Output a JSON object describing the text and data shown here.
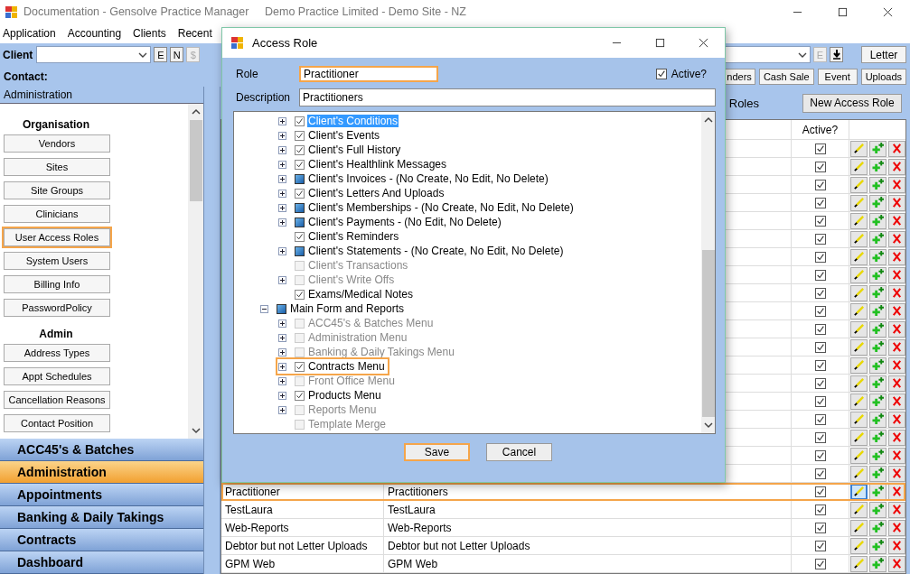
{
  "app": {
    "title": "Documentation - Gensolve Practice Manager",
    "subtitle": "Demo Practice Limited - Demo Site - NZ"
  },
  "menu": [
    "Application",
    "Accounting",
    "Clients",
    "Recent"
  ],
  "client_bar": {
    "label": "Client",
    "buttons": [
      {
        "label": "E",
        "disabled": false
      },
      {
        "label": "N",
        "disabled": false
      },
      {
        "label": "$",
        "disabled": true
      }
    ],
    "right_buttons": [
      {
        "kind": "text",
        "label": "E",
        "disabled": true
      },
      {
        "kind": "download",
        "disabled": false
      }
    ],
    "letter_button": "Letter"
  },
  "contact_label": "Contact:",
  "quick_buttons": [
    "nders",
    "Cash Sale",
    "Event",
    "Uploads"
  ],
  "sidebar": {
    "header": "Administration",
    "sections": [
      {
        "title": "Organisation",
        "buttons": [
          {
            "label": "Vendors",
            "highlighted": false
          },
          {
            "label": "Sites",
            "highlighted": false
          },
          {
            "label": "Site Groups",
            "highlighted": false
          },
          {
            "label": "Clinicians",
            "highlighted": false
          },
          {
            "label": "User Access Roles",
            "highlighted": true
          },
          {
            "label": "System Users",
            "highlighted": false
          },
          {
            "label": "Billing Info",
            "highlighted": false
          },
          {
            "label": "PasswordPolicy",
            "highlighted": false
          }
        ]
      },
      {
        "title": "Admin",
        "buttons": [
          {
            "label": "Address Types",
            "highlighted": false
          },
          {
            "label": "Appt Schedules",
            "highlighted": false
          },
          {
            "label": "Cancellation Reasons",
            "highlighted": false
          },
          {
            "label": "Contact Position",
            "highlighted": false
          }
        ]
      }
    ]
  },
  "nav": [
    {
      "label": "ACC45's & Batches",
      "selected": false
    },
    {
      "label": "Administration",
      "selected": true
    },
    {
      "label": "Appointments",
      "selected": false
    },
    {
      "label": "Banking & Daily Takings",
      "selected": false
    },
    {
      "label": "Contracts",
      "selected": false
    },
    {
      "label": "Dashboard",
      "selected": false
    }
  ],
  "roles_header": {
    "label": "Roles",
    "new_button": "New Access Role"
  },
  "table": {
    "active_header": "Active?",
    "rows": [
      {
        "active": true,
        "highlighted": false
      },
      {
        "active": true,
        "highlighted": false
      },
      {
        "active": true,
        "highlighted": false
      },
      {
        "active": true,
        "highlighted": false
      },
      {
        "active": true,
        "highlighted": false
      },
      {
        "active": true,
        "highlighted": false
      },
      {
        "active": true,
        "highlighted": false
      },
      {
        "active": true,
        "highlighted": false
      },
      {
        "active": true,
        "highlighted": false
      },
      {
        "active": true,
        "highlighted": false
      },
      {
        "active": true,
        "highlighted": false
      },
      {
        "active": true,
        "highlighted": false
      },
      {
        "active": true,
        "highlighted": false
      },
      {
        "active": true,
        "highlighted": false
      },
      {
        "active": true,
        "highlighted": false
      },
      {
        "active": true,
        "highlighted": false
      },
      {
        "active": true,
        "highlighted": false
      },
      {
        "active": true,
        "highlighted": false
      },
      {
        "active": true,
        "highlighted": false
      },
      {
        "name": "Practitioner",
        "description": "Practitioners",
        "active": true,
        "highlighted": true
      },
      {
        "name": "TestLaura",
        "description": "TestLaura",
        "active": true,
        "highlighted": false
      },
      {
        "name": "Web-Reports",
        "description": "Web-Reports",
        "active": true,
        "highlighted": false
      },
      {
        "name": "Debtor but not Letter Uploads",
        "description": "Debtor but not Letter Uploads",
        "active": true,
        "highlighted": false
      },
      {
        "name": "GPM Web",
        "description": "GPM Web",
        "active": true,
        "highlighted": false
      }
    ]
  },
  "dialog": {
    "title": "Access Role",
    "role_label": "Role",
    "role_value": "Practitioner",
    "role_focused": true,
    "active_label": "Active?",
    "active": true,
    "description_label": "Description",
    "description_value": "Practitioners",
    "tree": [
      {
        "children": [
          {
            "label": "Client's Conditions",
            "checked": true,
            "mixed": false,
            "expandable": true,
            "expanded": false,
            "selected": true,
            "highlighted": false
          },
          {
            "label": "Client's Events",
            "checked": true,
            "mixed": false,
            "expandable": true,
            "expanded": false,
            "selected": false,
            "highlighted": false
          },
          {
            "label": "Client's Full History",
            "checked": true,
            "mixed": false,
            "expandable": true,
            "expanded": false,
            "selected": false,
            "highlighted": false
          },
          {
            "label": "Client's Healthlink Messages",
            "checked": true,
            "mixed": false,
            "expandable": true,
            "expanded": false,
            "selected": false,
            "highlighted": false
          },
          {
            "label": "Client's Invoices - (No Create, No Edit, No Delete)",
            "mixed": true,
            "expandable": true,
            "expanded": false,
            "selected": false,
            "highlighted": false
          },
          {
            "label": "Client's Letters And Uploads",
            "checked": true,
            "mixed": false,
            "expandable": true,
            "expanded": false,
            "selected": false,
            "highlighted": false
          },
          {
            "label": "Client's Memberships - (No Create, No Edit, No Delete)",
            "mixed": true,
            "expandable": true,
            "expanded": false,
            "selected": false,
            "highlighted": false
          },
          {
            "label": "Client's Payments - (No Edit, No Delete)",
            "mixed": true,
            "expandable": true,
            "expanded": false,
            "selected": false,
            "highlighted": false
          },
          {
            "label": "Client's Reminders",
            "checked": true,
            "mixed": false,
            "expandable": false,
            "selected": false,
            "highlighted": false
          },
          {
            "label": "Client's Statements - (No Create, No Edit, No Delete)",
            "mixed": true,
            "expandable": true,
            "expanded": false,
            "selected": false,
            "highlighted": false
          },
          {
            "label": "Client's Transactions",
            "checked": false,
            "mixed": false,
            "expandable": false,
            "selected": false,
            "highlighted": false
          },
          {
            "label": "Client's Write Offs",
            "checked": false,
            "mixed": false,
            "expandable": true,
            "expanded": false,
            "selected": false,
            "highlighted": false
          },
          {
            "label": "Exams/Medical Notes",
            "checked": true,
            "mixed": false,
            "expandable": false,
            "selected": false,
            "highlighted": false
          }
        ]
      },
      {
        "label": "Main Form and Reports",
        "mixed": true,
        "expandable": true,
        "expanded": true,
        "selected": false,
        "highlighted": false,
        "children": [
          {
            "label": "ACC45's & Batches Menu",
            "checked": false,
            "mixed": false,
            "expandable": true,
            "expanded": false,
            "selected": false,
            "highlighted": false
          },
          {
            "label": "Administration Menu",
            "checked": false,
            "mixed": false,
            "expandable": true,
            "expanded": false,
            "selected": false,
            "highlighted": false
          },
          {
            "label": "Banking & Daily Takings Menu",
            "checked": false,
            "mixed": false,
            "expandable": true,
            "expanded": false,
            "selected": false,
            "highlighted": false
          },
          {
            "label": "Contracts Menu",
            "checked": true,
            "mixed": false,
            "expandable": true,
            "expanded": false,
            "selected": false,
            "highlighted": true
          },
          {
            "label": "Front Office Menu",
            "checked": false,
            "mixed": false,
            "expandable": true,
            "expanded": false,
            "selected": false,
            "highlighted": false
          },
          {
            "label": "Products Menu",
            "checked": true,
            "mixed": false,
            "expandable": true,
            "expanded": false,
            "selected": false,
            "highlighted": false
          },
          {
            "label": "Reports Menu",
            "checked": false,
            "mixed": false,
            "expandable": true,
            "expanded": false,
            "selected": false,
            "highlighted": false
          },
          {
            "label": "Template Merge",
            "checked": false,
            "mixed": false,
            "expandable": false,
            "selected": false,
            "highlighted": false
          }
        ]
      }
    ],
    "buttons": [
      {
        "label": "Save",
        "focused": true
      },
      {
        "label": "Cancel",
        "focused": false
      }
    ]
  }
}
